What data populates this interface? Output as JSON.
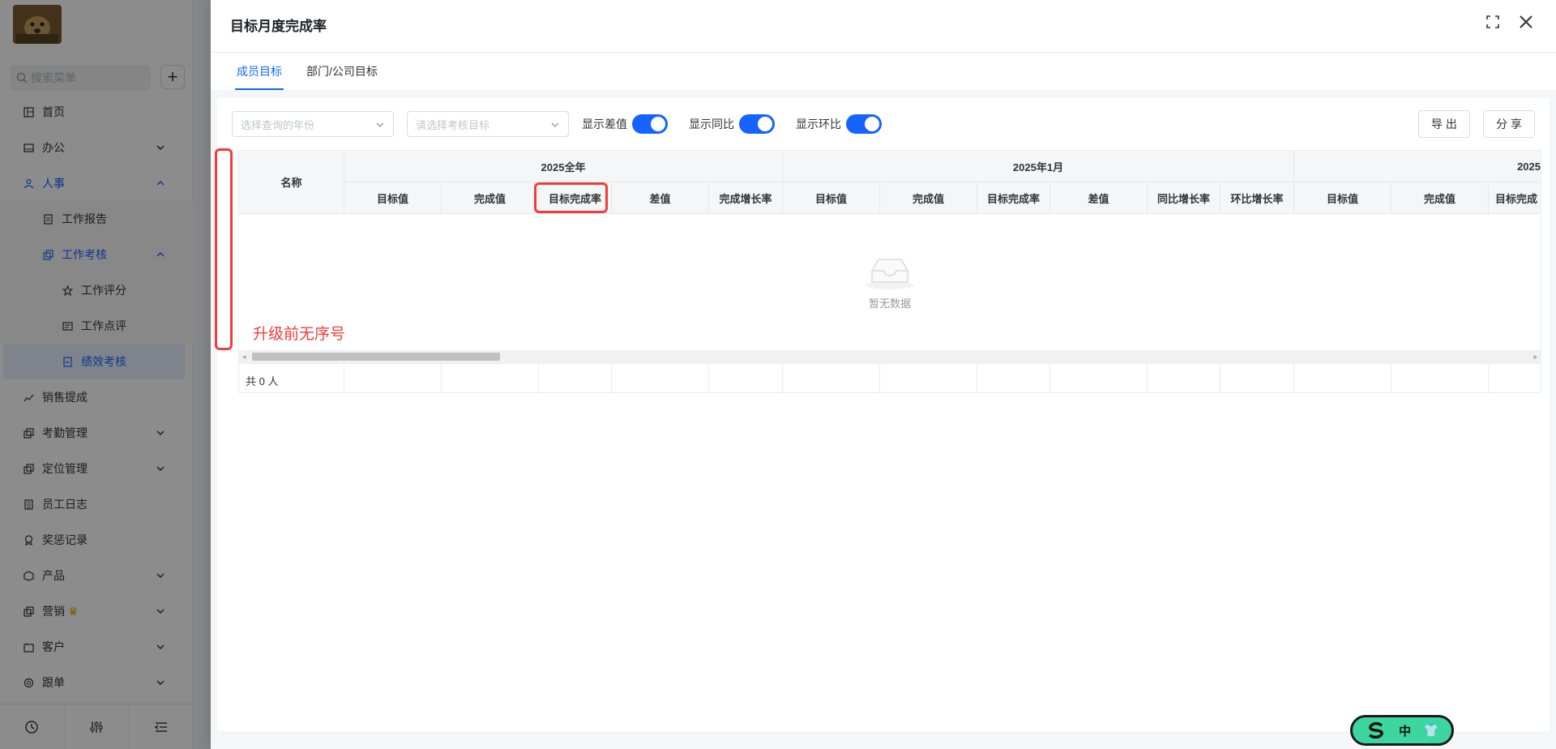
{
  "sidebar": {
    "search_placeholder": "搜索菜单",
    "items": [
      {
        "label": "首页"
      },
      {
        "label": "办公"
      },
      {
        "label": "人事"
      },
      {
        "label": "工作报告"
      },
      {
        "label": "工作考核"
      },
      {
        "label": "工作评分"
      },
      {
        "label": "工作点评"
      },
      {
        "label": "绩效考核"
      },
      {
        "label": "销售提成"
      },
      {
        "label": "考勤管理"
      },
      {
        "label": "定位管理"
      },
      {
        "label": "员工日志"
      },
      {
        "label": "奖惩记录"
      },
      {
        "label": "产品"
      },
      {
        "label": "营销"
      },
      {
        "label": "客户"
      },
      {
        "label": "跟单"
      }
    ]
  },
  "modal": {
    "title": "目标月度完成率",
    "tabs": [
      {
        "label": "成员目标"
      },
      {
        "label": "部门/公司目标"
      }
    ],
    "filters": {
      "year_placeholder": "选择查询的年份",
      "goal_placeholder": "请选择考核目标"
    },
    "toggles": [
      {
        "label": "显示差值",
        "on": true
      },
      {
        "label": "显示同比",
        "on": true
      },
      {
        "label": "显示环比",
        "on": true
      }
    ],
    "export_label": "导 出",
    "share_label": "分 享",
    "table": {
      "name_header": "名称",
      "groups": [
        "2025全年",
        "2025年1月",
        "2025"
      ],
      "columns": [
        "目标值",
        "完成值",
        "目标完成率",
        "差值",
        "完成增长率",
        "目标值",
        "完成值",
        "目标完成率",
        "差值",
        "同比增长率",
        "环比增长率",
        "目标值",
        "完成值",
        "目标完成"
      ],
      "empty_text": "暂无数据",
      "footer_total": "共 0 人"
    },
    "annotation": "升级前无序号"
  },
  "float_widget": {
    "text": "中"
  },
  "colors": {
    "accent": "#1664ff",
    "annotation": "#f23c3c"
  }
}
